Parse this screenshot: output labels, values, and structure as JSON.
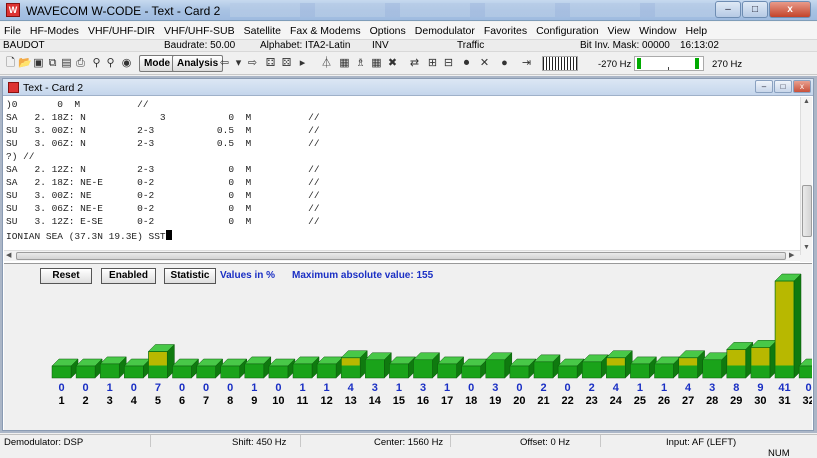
{
  "window": {
    "title": "WAVECOM W-CODE - Text - Card 2",
    "min": "–",
    "max": "□",
    "close": "x"
  },
  "menu": [
    "File",
    "HF-Modes",
    "VHF/UHF-DIR",
    "VHF/UHF-SUB",
    "Satellite",
    "Fax & Modems",
    "Options",
    "Demodulator",
    "Favorites",
    "Configuration",
    "View",
    "Window",
    "Help"
  ],
  "info": {
    "mode": "BAUDOT",
    "baudrate": "Baudrate: 50.00",
    "alphabet": "Alphabet: ITA2-Latin",
    "inv": "INV",
    "traffic": "Traffic",
    "bitinv": "Bit Inv. Mask: 00000",
    "time": "16:13:02"
  },
  "toolbar": {
    "mode_label": "Mode",
    "analysis_label": "Analysis",
    "freq_left": "-270 Hz",
    "freq_right": "270 Hz"
  },
  "child": {
    "title": "Text - Card 2"
  },
  "text_lines": [
    ")0       0  M          //",
    "SA   2. 18Z: N             3           0  M          //",
    "SU   3. 00Z: N         2-3           0.5  M          //",
    "SU   3. 06Z: N         2-3           0.5  M          //",
    "?) //",
    "SA   2. 12Z: N         2-3             0  M          //",
    "SA   2. 18Z: NE-E      0-2             0  M          //",
    "SU   3. 00Z: NE        0-2             0  M          //",
    "SU   3. 06Z: NE-E      0-2             0  M          //",
    "SU   3. 12Z: E-SE      0-2             0  M          //",
    "IONIAN SEA (37.3N 19.3E) SST"
  ],
  "histogram": {
    "reset_label": "Reset",
    "enabled_label": "Enabled",
    "statistic_label": "Statistic",
    "values_label": "Values in %",
    "max_label": "Maximum absolute value: 155",
    "percent_symbol": "%",
    "colors": {
      "green": "#1aa31a",
      "yellow": "#b8b800",
      "blue_text": "#1a2fc4"
    }
  },
  "chart_data": {
    "type": "bar",
    "categories": [
      "1",
      "2",
      "3",
      "4",
      "5",
      "6",
      "7",
      "8",
      "9",
      "10",
      "11",
      "12",
      "13",
      "14",
      "15",
      "16",
      "17",
      "18",
      "19",
      "20",
      "21",
      "22",
      "23",
      "24",
      "25",
      "26",
      "27",
      "28",
      "29",
      "30",
      "31",
      "32"
    ],
    "values": [
      0,
      0,
      1,
      0,
      7,
      0,
      0,
      0,
      1,
      0,
      1,
      1,
      4,
      3,
      1,
      3,
      1,
      0,
      3,
      0,
      2,
      0,
      2,
      4,
      1,
      1,
      4,
      3,
      8,
      9,
      41,
      0
    ],
    "unit": "%",
    "ylim": [
      0,
      41
    ]
  },
  "status": {
    "demodulator": "Demodulator: DSP",
    "shift": "Shift: 450 Hz",
    "center": "Center: 1560 Hz",
    "offset": "Offset: 0 Hz",
    "input": "Input: AF (LEFT)",
    "num": "NUM"
  }
}
